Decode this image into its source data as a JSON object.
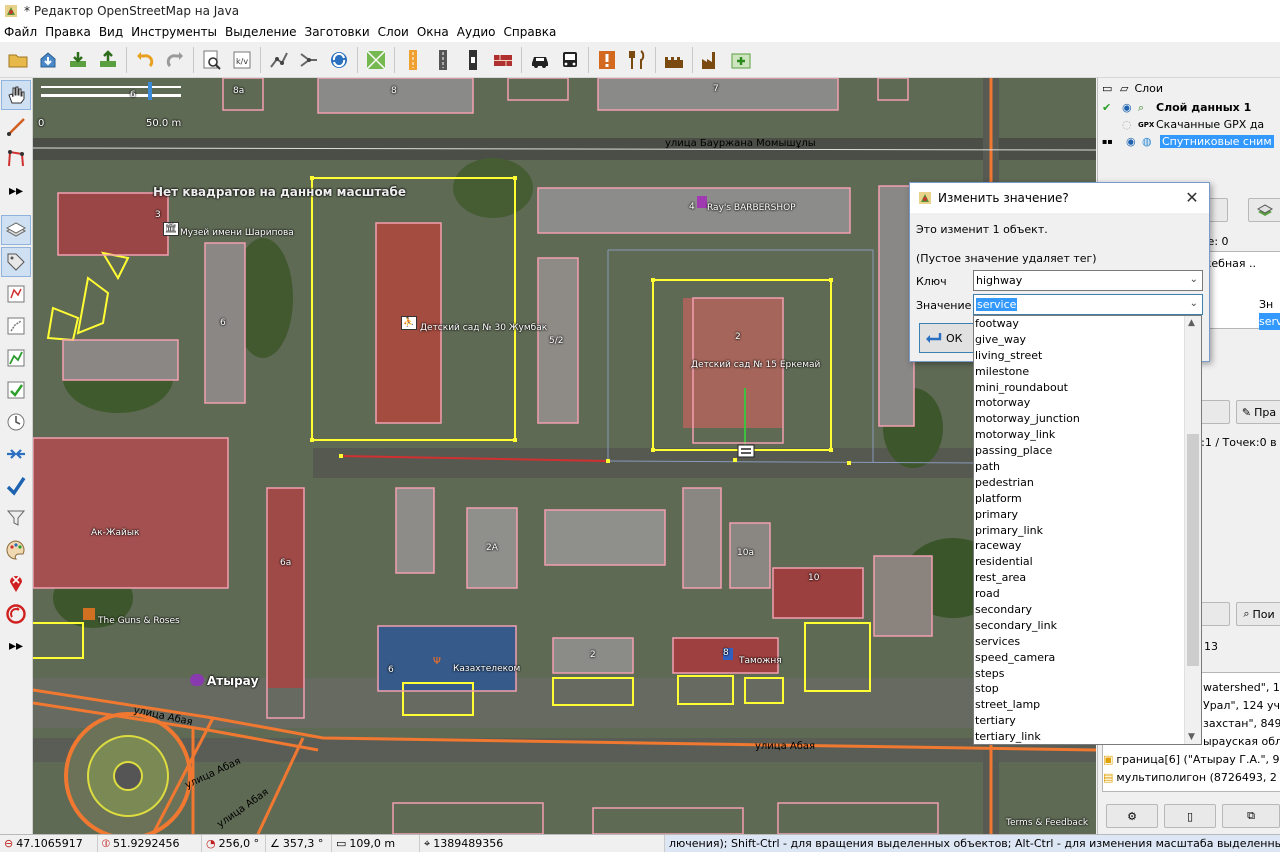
{
  "window": {
    "title": "* Редактор OpenStreetMap на Java"
  },
  "menu": [
    "Файл",
    "Правка",
    "Вид",
    "Инструменты",
    "Выделение",
    "Заготовки",
    "Слои",
    "Окна",
    "Аудио",
    "Справка"
  ],
  "map": {
    "scale_label": "50.0 m",
    "scale_zero": "0",
    "no_tiles_notice": "Нет квадратов на данном масштабе",
    "streets": [
      "улица Бауржана Момышұлы",
      "улица Абая",
      "улица Абая",
      "улица Абая",
      "улица Абая"
    ],
    "pois": [
      "Музей имени Шарипова",
      "Детский сад № 30 Жумбак",
      "Ray's BARBERSHOP",
      "Детский сад № 15 Еркемай",
      "Ак-Жайык",
      "The Guns & Roses",
      "Казахтелеком",
      "Таможня",
      "Атырау"
    ],
    "house_numbers": [
      "6",
      "8a",
      "8",
      "7",
      "3",
      "4",
      "6",
      "5/2",
      "2",
      "2A",
      "10a",
      "10",
      "6a",
      "6",
      "2",
      "8"
    ],
    "attribution": "Terms & Feedback"
  },
  "layers_panel": {
    "header": "Слои",
    "layers": [
      {
        "name": "Слой данных 1",
        "bold": true
      },
      {
        "name": "Скачанные GPX да",
        "prefix": "GPX"
      },
      {
        "name": "Спутниковые сним",
        "selected": true
      }
    ]
  },
  "right_fragments": {
    "count_label": "тие: 0",
    "tag_row": "ужебная ..",
    "col_header": "Зн",
    "col_value": "serv",
    "edit_button": "Пра",
    "selection_info": "й:1 / Точек:0 в",
    "paren": ")",
    "search_button": "Пои",
    "num_13": "13",
    "relations": [
      "watershed\", 17",
      "Урал\", 124 участ",
      "захстан\", 849 уч",
      "ырауская облас",
      "граница[6] (\"Атырау Г.А.\", 9 уч",
      "мультиполигон (8726493, 2 уча"
    ]
  },
  "dialog": {
    "title": "Изменить значение?",
    "info": "Это изменит 1 объект.",
    "hint": "(Пустое значение удаляет тег)",
    "key_label": "Ключ",
    "key_value": "highway",
    "value_label": "Значение",
    "value_value": "service",
    "ok_label": "ОК"
  },
  "dropdown_options": [
    "footway",
    "give_way",
    "living_street",
    "milestone",
    "mini_roundabout",
    "motorway",
    "motorway_junction",
    "motorway_link",
    "passing_place",
    "path",
    "pedestrian",
    "platform",
    "primary",
    "primary_link",
    "raceway",
    "residential",
    "rest_area",
    "road",
    "secondary",
    "secondary_link",
    "services",
    "speed_camera",
    "steps",
    "stop",
    "street_lamp",
    "tertiary",
    "tertiary_link"
  ],
  "statusbar": {
    "lat": "47.1065917",
    "lon": "51.9292456",
    "heading": "256,0 °",
    "angle": "357,3 °",
    "distance": "109,0 m",
    "object_id": "1389489356",
    "help": "лючения); Shift-Ctrl - для вращения выделенных объектов; Alt-Ctrl - для изменения масштаба выделенных объектов; и..."
  },
  "colors": {
    "accent": "#3399ff",
    "selection_yellow": "#ffff33",
    "building_pink": "#f2a0b0",
    "road_orange": "#f07830",
    "selected_way_red": "#e03030"
  }
}
